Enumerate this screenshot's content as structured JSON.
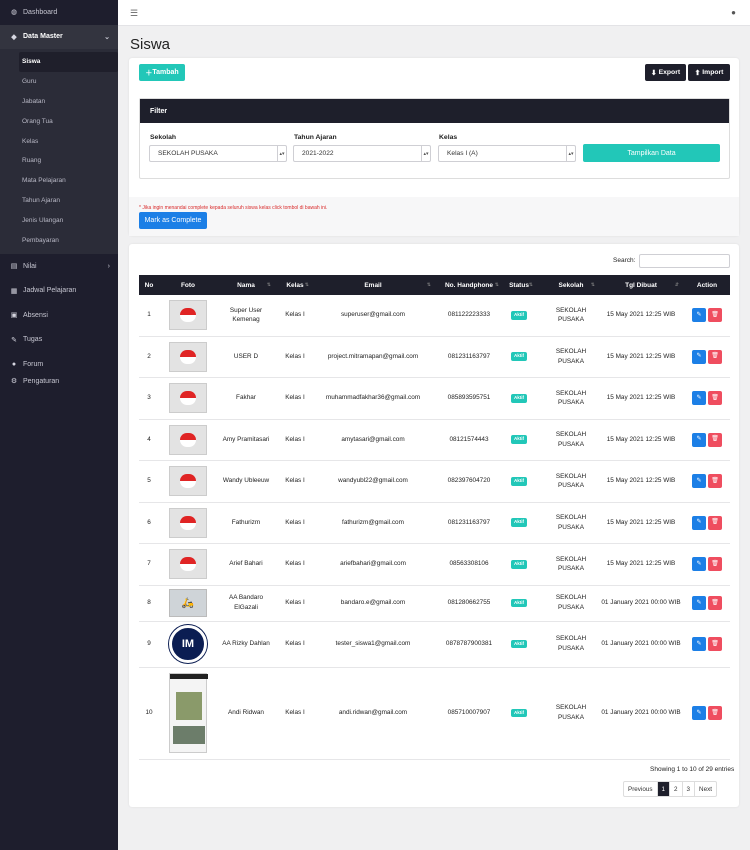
{
  "sidebar": {
    "items": [
      {
        "label": "Dashboard",
        "icon": "dashboard-icon"
      },
      {
        "label": "Data Master",
        "icon": "tag-icon"
      },
      {
        "label": "Nilai",
        "icon": "book-icon"
      },
      {
        "label": "Jadwal Pelajaran",
        "icon": "calendar-icon"
      },
      {
        "label": "Absensi",
        "icon": "clipboard-icon"
      },
      {
        "label": "Tugas",
        "icon": "paperclip-icon"
      },
      {
        "label": "Forum",
        "icon": "chat-icon"
      },
      {
        "label": "Pengaturan",
        "icon": "gear-icon"
      }
    ],
    "sub_items": [
      "Siswa",
      "Guru",
      "Jabatan",
      "Orang Tua",
      "Kelas",
      "Ruang",
      "Mata Pelajaran",
      "Tahun Ajaran",
      "Jenis Ulangan",
      "Pembayaran"
    ]
  },
  "page": {
    "title": "Siswa"
  },
  "toolbar": {
    "tambah": "Tambah",
    "export": "Export",
    "import": "Import"
  },
  "filter": {
    "title": "Filter",
    "sekolah_label": "Sekolah",
    "sekolah_value": "SEKOLAH PUSAKA",
    "tahun_label": "Tahun Ajaran",
    "tahun_value": "2021-2022",
    "kelas_label": "Kelas",
    "kelas_value": "Kelas I (A)",
    "button": "Tampilkan Data"
  },
  "note": "* Jika ingin menandai complete kepada seluruh siswa kelas click tombol di bawah ini.",
  "complete_button": "Mark as Complete",
  "search": {
    "label": "Search:"
  },
  "table": {
    "headers": [
      "No",
      "Foto",
      "Nama",
      "Kelas",
      "Email",
      "No. Handphone",
      "Status",
      "Sekolah",
      "Tgl Dibuat",
      "Action"
    ],
    "rows": [
      {
        "no": "1",
        "nama": "Super User Kemenag",
        "kelas": "Kelas I",
        "email": "superuser@gmail.com",
        "hp": "081122223333",
        "status": "Aktif",
        "sekolah": "SEKOLAH PUSAKA",
        "tgl": "15 May 2021 12:25 WIB"
      },
      {
        "no": "2",
        "nama": "USER D",
        "kelas": "Kelas I",
        "email": "project.mitramapan@gmail.com",
        "hp": "081231163797",
        "status": "Aktif",
        "sekolah": "SEKOLAH PUSAKA",
        "tgl": "15 May 2021 12:25 WIB"
      },
      {
        "no": "3",
        "nama": "Fakhar",
        "kelas": "Kelas I",
        "email": "muhammadfakhar36@gmail.com",
        "hp": "085893595751",
        "status": "Aktif",
        "sekolah": "SEKOLAH PUSAKA",
        "tgl": "15 May 2021 12:25 WIB"
      },
      {
        "no": "4",
        "nama": "Amy Pramitasari",
        "kelas": "Kelas I",
        "email": "amytasari@gmail.com",
        "hp": "08121574443",
        "status": "Aktif",
        "sekolah": "SEKOLAH PUSAKA",
        "tgl": "15 May 2021 12:25 WIB"
      },
      {
        "no": "5",
        "nama": "Wandy Ubleeuw",
        "kelas": "Kelas I",
        "email": "wandyubl22@gmail.com",
        "hp": "082397604720",
        "status": "Aktif",
        "sekolah": "SEKOLAH PUSAKA",
        "tgl": "15 May 2021 12:25 WIB"
      },
      {
        "no": "6",
        "nama": "Fathurizm",
        "kelas": "Kelas I",
        "email": "fathurizm@gmail.com",
        "hp": "081231163797",
        "status": "Aktif",
        "sekolah": "SEKOLAH PUSAKA",
        "tgl": "15 May 2021 12:25 WIB"
      },
      {
        "no": "7",
        "nama": "Arief Bahari",
        "kelas": "Kelas I",
        "email": "ariefbahari@gmail.com",
        "hp": "08563308106",
        "status": "Aktif",
        "sekolah": "SEKOLAH PUSAKA",
        "tgl": "15 May 2021 12:25 WIB"
      },
      {
        "no": "8",
        "nama": "AA Bandaro ElGazali",
        "kelas": "Kelas I",
        "email": "bandaro.e@gmail.com",
        "hp": "081280662755",
        "status": "Aktif",
        "sekolah": "SEKOLAH PUSAKA",
        "tgl": "01 January 2021 00:00 WIB"
      },
      {
        "no": "9",
        "nama": "AA Rizky Dahlan",
        "kelas": "Kelas I",
        "email": "tester_siswa1@gmail.com",
        "hp": "0878787900381",
        "status": "Aktif",
        "sekolah": "SEKOLAH PUSAKA",
        "tgl": "01 January 2021 00:00 WIB"
      },
      {
        "no": "10",
        "nama": "Andi Ridwan",
        "kelas": "Kelas I",
        "email": "andi.ridwan@gmail.com",
        "hp": "085710007907",
        "status": "Aktif",
        "sekolah": "SEKOLAH PUSAKA",
        "tgl": "01 January 2021 00:00 WIB"
      }
    ]
  },
  "info": "Showing 1 to 10 of 29 entries",
  "pagination": {
    "previous": "Previous",
    "pages": [
      "1",
      "2",
      "3"
    ],
    "next": "Next"
  }
}
